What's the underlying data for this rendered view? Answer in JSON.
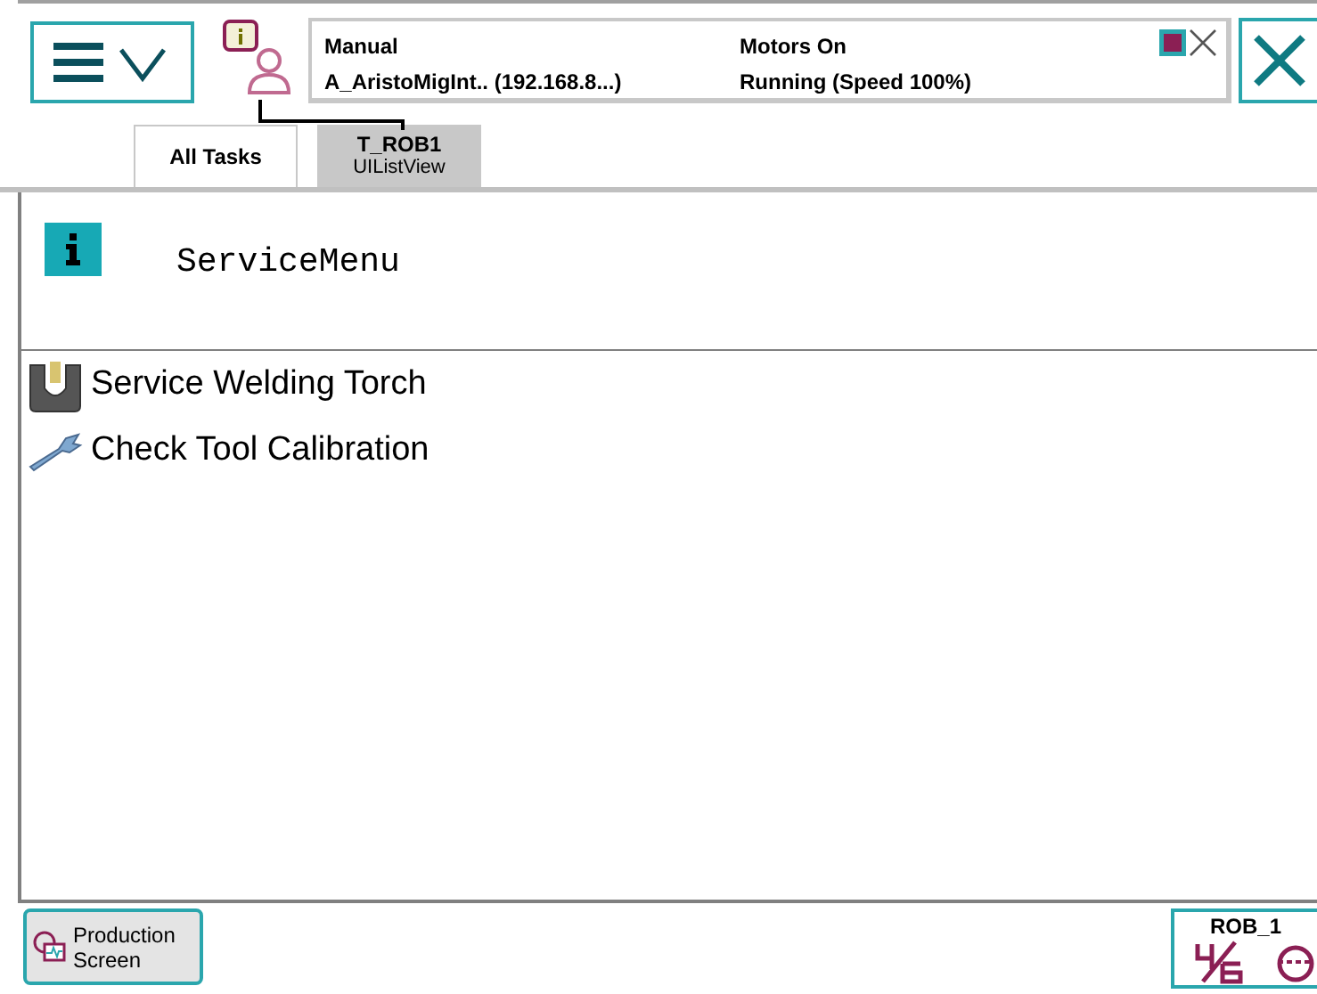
{
  "status": {
    "mode": "Manual",
    "controller": "A_AristoMigInt.. (192.168.8...)",
    "motors": "Motors On",
    "state": "Running (Speed 100%)"
  },
  "tabs": [
    {
      "label": "All Tasks",
      "selected": false
    },
    {
      "label": "T_ROB1",
      "sublabel": "UIListView",
      "selected": true
    }
  ],
  "header": {
    "title": "ServiceMenu"
  },
  "items": [
    {
      "kind": "torch",
      "label": "Service Welding Torch"
    },
    {
      "kind": "wrench",
      "label": "Check Tool Calibration"
    }
  ],
  "taskbar": {
    "app": "Production Screen",
    "unit": "ROB_1"
  }
}
